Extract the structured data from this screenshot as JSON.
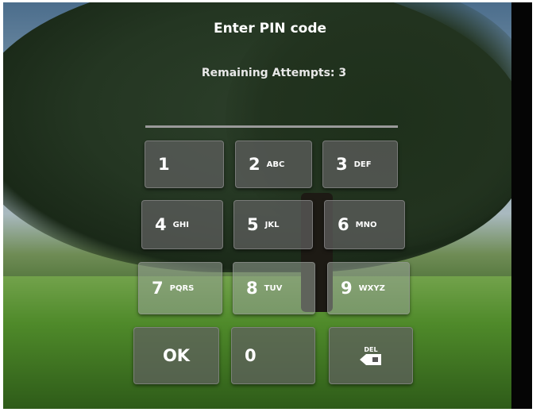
{
  "prompt": {
    "title": "Enter PIN code",
    "remaining": "Remaining Attempts: 3"
  },
  "keypad": {
    "keys": [
      {
        "digit": "1",
        "letters": ""
      },
      {
        "digit": "2",
        "letters": "ABC"
      },
      {
        "digit": "3",
        "letters": "DEF"
      },
      {
        "digit": "4",
        "letters": "GHI"
      },
      {
        "digit": "5",
        "letters": "JKL"
      },
      {
        "digit": "6",
        "letters": "MNO"
      },
      {
        "digit": "7",
        "letters": "PQRS"
      },
      {
        "digit": "8",
        "letters": "TUV"
      },
      {
        "digit": "9",
        "letters": "WXYZ"
      }
    ],
    "ok_label": "OK",
    "zero": "0",
    "del_label": "DEL"
  }
}
